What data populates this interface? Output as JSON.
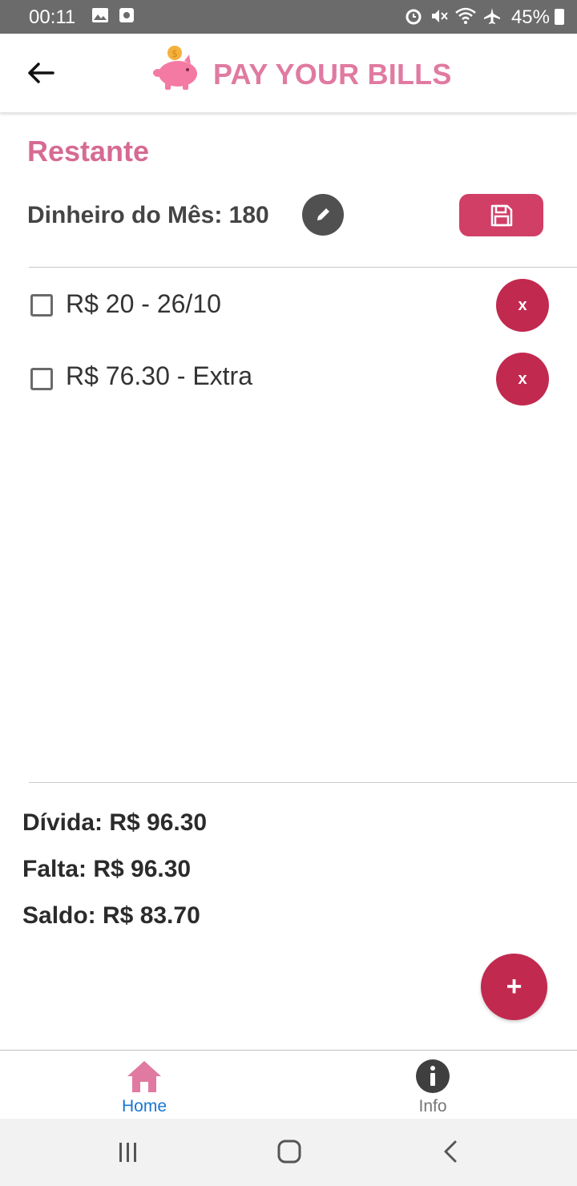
{
  "status_bar": {
    "time": "00:11",
    "battery": "45%",
    "icons": [
      "image-icon",
      "screenshot-icon",
      "alarm-icon",
      "mute-icon",
      "wifi-icon",
      "airplane-icon",
      "battery-icon"
    ]
  },
  "app_bar": {
    "title": "PAY YOUR BILLS",
    "back_icon": "arrow-left-icon",
    "logo_icon": "piggy-bank-icon"
  },
  "main": {
    "section_title": "Restante",
    "monthly_money_label": "Dinheiro do Mês: 180",
    "edit_icon": "pencil-icon",
    "save_icon": "floppy-disk-icon",
    "bills": [
      {
        "label": "R$ 20 - 26/10",
        "checked": false,
        "delete_label": "x"
      },
      {
        "label": "R$ 76.30 - Extra",
        "checked": false,
        "delete_label": "x"
      }
    ]
  },
  "summary": {
    "divida": "Dívida: R$ 96.30",
    "falta": "Falta: R$ 96.30",
    "saldo": "Saldo: R$ 83.70"
  },
  "fab_label": "+",
  "bottom_nav": {
    "items": [
      {
        "label": "Home",
        "icon": "home-icon",
        "active": true
      },
      {
        "label": "Info",
        "icon": "info-icon",
        "active": false
      }
    ]
  },
  "colors": {
    "brand_pink": "#e07aa0",
    "accent_red": "#c2294f",
    "save_red": "#d13e66",
    "active_nav": "#1976d2",
    "inactive_nav": "#757575"
  }
}
